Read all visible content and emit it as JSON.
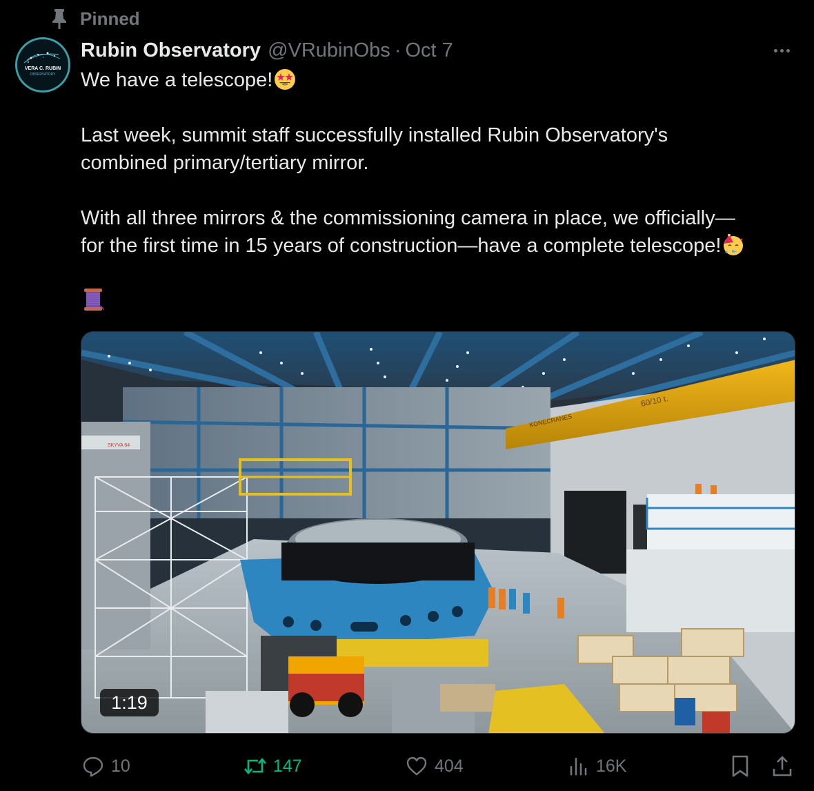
{
  "pinned": {
    "label": "Pinned"
  },
  "author": {
    "name": "Rubin Observatory",
    "handle": "@VRubinObs",
    "separator": "·",
    "date": "Oct 7",
    "avatar_text_line1": "VERA C. RUBIN",
    "avatar_text_line2": "OBSERVATORY"
  },
  "tweet": {
    "line1": "We have a telescope!",
    "line2": "Last week, summit staff successfully installed Rubin Observatory's",
    "line3": "combined primary/tertiary mirror.",
    "line4": "With all three mirrors & the commissioning camera in place, we officially—",
    "line5": "for the first time in 15 years of construction—have a complete telescope!",
    "emoji_1": "star-struck",
    "emoji_2": "partying-face",
    "emoji_3": "thread-spool"
  },
  "media": {
    "duration": "1:19",
    "crane_label": "60/10 t.",
    "crane_brand": "KONECRANES",
    "lift_label": "SKYVA 64"
  },
  "actions": {
    "reply_count": "10",
    "retweet_count": "147",
    "like_count": "404",
    "views_count": "16K"
  },
  "colors": {
    "background": "#000000",
    "text": "#e7e9ea",
    "muted": "#71767b",
    "retweet_active": "#00ba7c"
  }
}
